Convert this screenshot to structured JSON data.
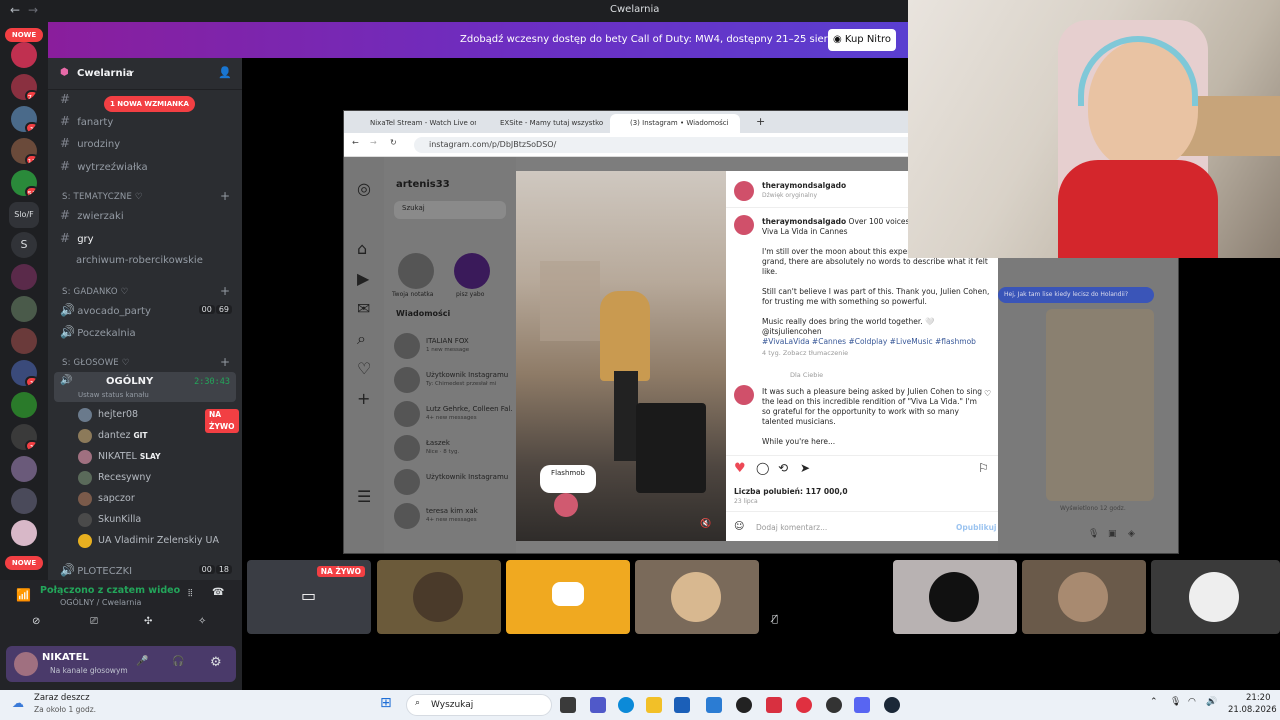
{
  "window": {
    "title": "Cwelarnia"
  },
  "banner": {
    "text": "Zdobądź wczesny dostęp do bety Call of Duty: MW4, dostępny 21–25 sierpnia.",
    "button": "Kup Nitro"
  },
  "rail": {
    "badges": [
      "NOWE",
      "74",
      "1",
      "12",
      "53",
      "Slo/F",
      "S",
      "1",
      "1",
      "NOWE"
    ]
  },
  "server": {
    "name": "Cwelarnia",
    "mention_pill": "1 NOWA WZMIANKA",
    "channels_top": [
      "fanarty",
      "urodziny",
      "wytrzeźwiałka"
    ],
    "category_tematyczne": "S: TEMATYCZNE ♡",
    "channels_tematyczne": [
      "zwierzaki",
      "gry",
      "archiwum-robercikowskie"
    ],
    "category_gadanko": "S: GADANKO ♡",
    "voice_gadanko": [
      {
        "name": "avocado_party",
        "count_a": "00",
        "count_b": "69"
      },
      {
        "name": "Poczekalnia"
      }
    ],
    "category_glosowe": "S: GŁOSOWE ♡",
    "voice_ogolny": {
      "name": "OGÓLNY",
      "time": "2:30:43",
      "status": "Ustaw status kanału"
    },
    "voice_users": [
      {
        "name": "hejter08",
        "tag": "NA ŻYWO",
        "color": "#6a7a8c"
      },
      {
        "name": "dantez",
        "tag": "GIT",
        "color": "#8c7a5a"
      },
      {
        "name": "NIKATEL",
        "tag": "SLAY",
        "color": "#a07080"
      },
      {
        "name": "Recesywny",
        "tag": "",
        "color": "#5a6a5a"
      },
      {
        "name": "sapczor",
        "tag": "",
        "color": "#7a5a4a"
      },
      {
        "name": "SkunKilla",
        "tag": "",
        "color": "#4a4a4a"
      },
      {
        "name": "UA Vladimir Zelenskiy UA",
        "tag": "",
        "color": "#e8b020"
      }
    ],
    "voice_ploteczki": {
      "name": "PLOTECZKI",
      "count_a": "00",
      "count_b": "18"
    }
  },
  "voice_panel": {
    "status": "Połączono z czatem wideo",
    "channel": "OGÓLNY / Cwelarnia"
  },
  "user_panel": {
    "name": "NIKATEL",
    "status": "Na kanale głosowym"
  },
  "browser": {
    "tabs": [
      "NixaTel Stream - Watch Live on",
      "EXSite - Mamy tutaj wszystko",
      "(3) Instagram • Wiadomości"
    ],
    "url": "instagram.com/p/DbJBtzSoDSO/"
  },
  "instagram": {
    "account": "artenis33",
    "search_placeholder": "Szukaj",
    "messages_header": "Wiadomości",
    "story_labels": [
      "Twoja notatka",
      "pisz yabo"
    ],
    "conversations": [
      {
        "name": "ITALIAN FOX",
        "sub": "1 new message"
      },
      {
        "name": "Użytkownik Instagramu",
        "sub": "Ty: Chimedest przesłał mi"
      },
      {
        "name": "Lutz Gehrke, Colleen Fal...",
        "sub": "4+ new messages"
      },
      {
        "name": "Łaszek",
        "sub": "Nice · 8 tyg."
      },
      {
        "name": "Użytkownik Instagramu",
        "sub": ""
      },
      {
        "name": "teresa kim xak",
        "sub": "4+ new messages"
      }
    ],
    "video_sticker": "Flashmob",
    "post": {
      "author": "theraymondsalgado",
      "author_sub": "Dźwięk oryginalny",
      "caption_lead": "Over 100 voices. One...",
      "caption_line2": "Viva La Vida in Cannes",
      "para1": "I'm still over the moon about this experience... something so grand, there are absolutely no words to describe what it felt like.",
      "para2": "Still can't believe I was part of this. Thank you, Julien Cohen, for trusting me with something so powerful.",
      "para3": "Music really does bring the world together. 🤍 @itsjuliencohen",
      "hashtags": "#VivaLaVida #Cannes #Coldplay #LiveMusic #flashmob",
      "meta": "4 tyg.   Zobacz tłumaczenie",
      "for_you": "Dla Ciebie",
      "comment": "It was such a pleasure being asked by Julien Cohen to sing the lead on this incredible rendition of \"Viva La Vida.\" I'm so grateful for the opportunity to work with so many talented musicians.",
      "comment2": "While you're here...",
      "likes": "Liczba polubień: 117 000,0",
      "date": "23 lipca",
      "add_comment": "Dodaj komentarz...",
      "publish": "Opublikuj"
    },
    "chat_bubble": "Hej, Jak tam lise kiedy lecisz do Holandii?",
    "chat_seen": "Wyświetlono 12 godz."
  },
  "tiles": {
    "live_label": "NA ŻYWO"
  },
  "taskbar": {
    "weather_title": "Zaraz deszcz",
    "weather_sub": "Za około 1 godz.",
    "search": "Wyszukaj",
    "time": "21:20",
    "date": "21.08.2026"
  }
}
